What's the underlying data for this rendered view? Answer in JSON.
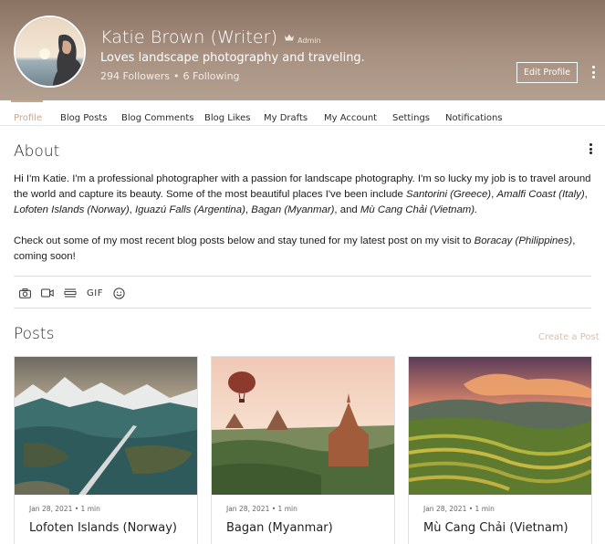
{
  "profile": {
    "name": "Katie Brown (Writer)",
    "role": "Admin",
    "tagline": "Loves landscape photography and traveling.",
    "followers": "294 Followers",
    "following": "6 Following",
    "edit_label": "Edit Profile"
  },
  "tabs": [
    "Profile",
    "Blog Posts",
    "Blog Comments",
    "Blog Likes",
    "My Drafts",
    "My Account",
    "Settings",
    "Notifications"
  ],
  "about": {
    "title": "About",
    "p1_a": "Hi I'm Katie. I'm a professional photographer with a passion for landscape photography. I'm so lucky my job is to travel around the world and capture its beauty. Some of the most beautiful places I've been include ",
    "p1_places1": "Santorini (Greece)",
    "p1_sep1": ", ",
    "p1_places2": "Amalfi Coast (Italy)",
    "p1_sep2": ", ",
    "p1_places3": "Lofoten Islands (Norway)",
    "p1_sep3": ", ",
    "p1_places4": "Iguazú Falls (Argentina)",
    "p1_sep4": ", ",
    "p1_places5": "Bagan (Myanmar)",
    "p1_sep5": ", and ",
    "p1_places6": "Mù Cang Chải (Vietnam).",
    "p2_a": "Check out some of my most recent blog posts below and stay tuned for my latest post on my visit to ",
    "p2_place": "Boracay (Philippines)",
    "p2_b": ", coming soon!"
  },
  "toolbar": {
    "gif_label": "GIF"
  },
  "posts": {
    "title": "Posts",
    "create_label": "Create a Post",
    "items": [
      {
        "date": "Jan 28, 2021",
        "read": "1 min",
        "title": "Lofoten Islands (Norway)"
      },
      {
        "date": "Jan 28, 2021",
        "read": "1 min",
        "title": "Bagan (Myanmar)"
      },
      {
        "date": "Jan 28, 2021",
        "read": "1 min",
        "title": "Mù Cang Chải (Vietnam)"
      }
    ]
  },
  "colors": {
    "accent": "#c6a78f",
    "header": "#a89181"
  }
}
